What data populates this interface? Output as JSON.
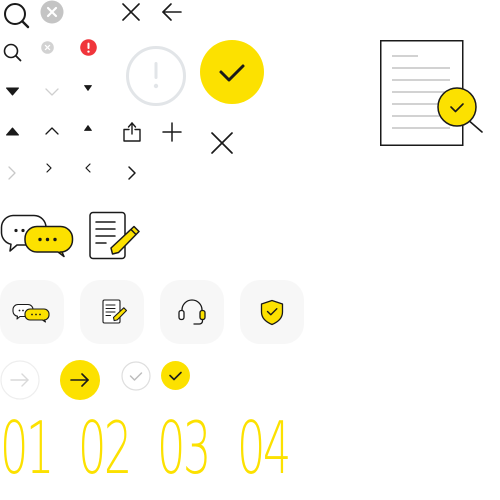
{
  "colors": {
    "accent_yellow": "#FCE100",
    "error_red": "#F0353B",
    "icon_dark": "#1A1A1A",
    "icon_grey": "#B4B4B4",
    "icon_light_grey": "#CFCFCF",
    "circle_light_grey": "#E2E5E8",
    "tile_background": "#F7F7F7"
  },
  "icons": [
    "search-icon-large",
    "clear-circle-icon-large",
    "close-icon-large",
    "back-arrow-icon",
    "search-icon-small",
    "clear-circle-icon-small",
    "error-badge-icon",
    "info-exclamation-circle-icon",
    "success-check-circle-icon",
    "document-search-illustration",
    "caret-down-filled-icon",
    "chevron-down-light-icon",
    "caret-down-small-icon",
    "caret-up-filled-icon",
    "chevron-up-icon",
    "caret-up-small-icon",
    "share-icon",
    "plus-icon",
    "close-icon-medium",
    "chevron-right-light-icon",
    "chevron-right-small-icon",
    "chevron-left-small-icon",
    "chevron-right-icon",
    "chat-bubbles-icon",
    "document-edit-icon",
    "chat-tile-icon",
    "document-edit-tile-icon",
    "headset-tile-icon",
    "shield-check-tile-icon",
    "arrow-right-circle-inactive-icon",
    "arrow-right-circle-active-icon",
    "check-circle-inactive-icon",
    "check-circle-active-icon"
  ],
  "steps": {
    "step_1": "01",
    "step_2": "02",
    "step_3": "03",
    "step_4": "04"
  }
}
